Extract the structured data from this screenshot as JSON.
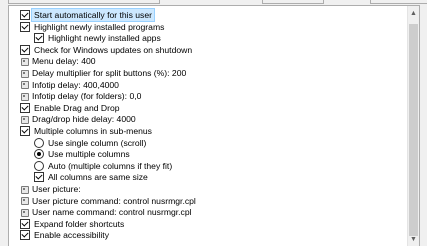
{
  "options": [
    {
      "label": "Start automatically for this user",
      "control": "checkbox",
      "checked": true,
      "indent": 0,
      "selected": true
    },
    {
      "label": "Highlight newly installed programs",
      "control": "checkbox",
      "checked": true,
      "indent": 0
    },
    {
      "label": "Highlight newly installed apps",
      "control": "checkbox",
      "checked": true,
      "indent": 1
    },
    {
      "label": "Check for Windows updates on shutdown",
      "control": "checkbox",
      "checked": true,
      "indent": 0
    },
    {
      "label": "Menu delay: 400",
      "control": "value",
      "indent": 0
    },
    {
      "label": "Delay multiplier for split buttons (%): 200",
      "control": "value",
      "indent": 0
    },
    {
      "label": "Infotip delay: 400,4000",
      "control": "value",
      "indent": 0
    },
    {
      "label": "Infotip delay (for folders): 0,0",
      "control": "value",
      "indent": 0
    },
    {
      "label": "Enable Drag and Drop",
      "control": "checkbox",
      "checked": true,
      "indent": 0
    },
    {
      "label": "Drag/drop hide delay: 4000",
      "control": "value",
      "indent": 0
    },
    {
      "label": "Multiple columns in sub-menus",
      "control": "checkbox",
      "checked": true,
      "indent": 0
    },
    {
      "label": "Use single column (scroll)",
      "control": "radio",
      "checked": false,
      "indent": 1
    },
    {
      "label": "Use multiple columns",
      "control": "radio",
      "checked": true,
      "indent": 1
    },
    {
      "label": "Auto (multiple columns if they fit)",
      "control": "radio",
      "checked": false,
      "indent": 1
    },
    {
      "label": "All columns are same size",
      "control": "checkbox",
      "checked": true,
      "indent": 1
    },
    {
      "label": "User picture:",
      "control": "value",
      "indent": 0
    },
    {
      "label": "User picture command: control nusrmgr.cpl",
      "control": "value",
      "indent": 0
    },
    {
      "label": "User name command: control nusrmgr.cpl",
      "control": "value",
      "indent": 0
    },
    {
      "label": "Expand folder shortcuts",
      "control": "checkbox",
      "checked": true,
      "indent": 0
    },
    {
      "label": "Enable accessibility",
      "control": "checkbox",
      "checked": true,
      "indent": 0
    }
  ]
}
